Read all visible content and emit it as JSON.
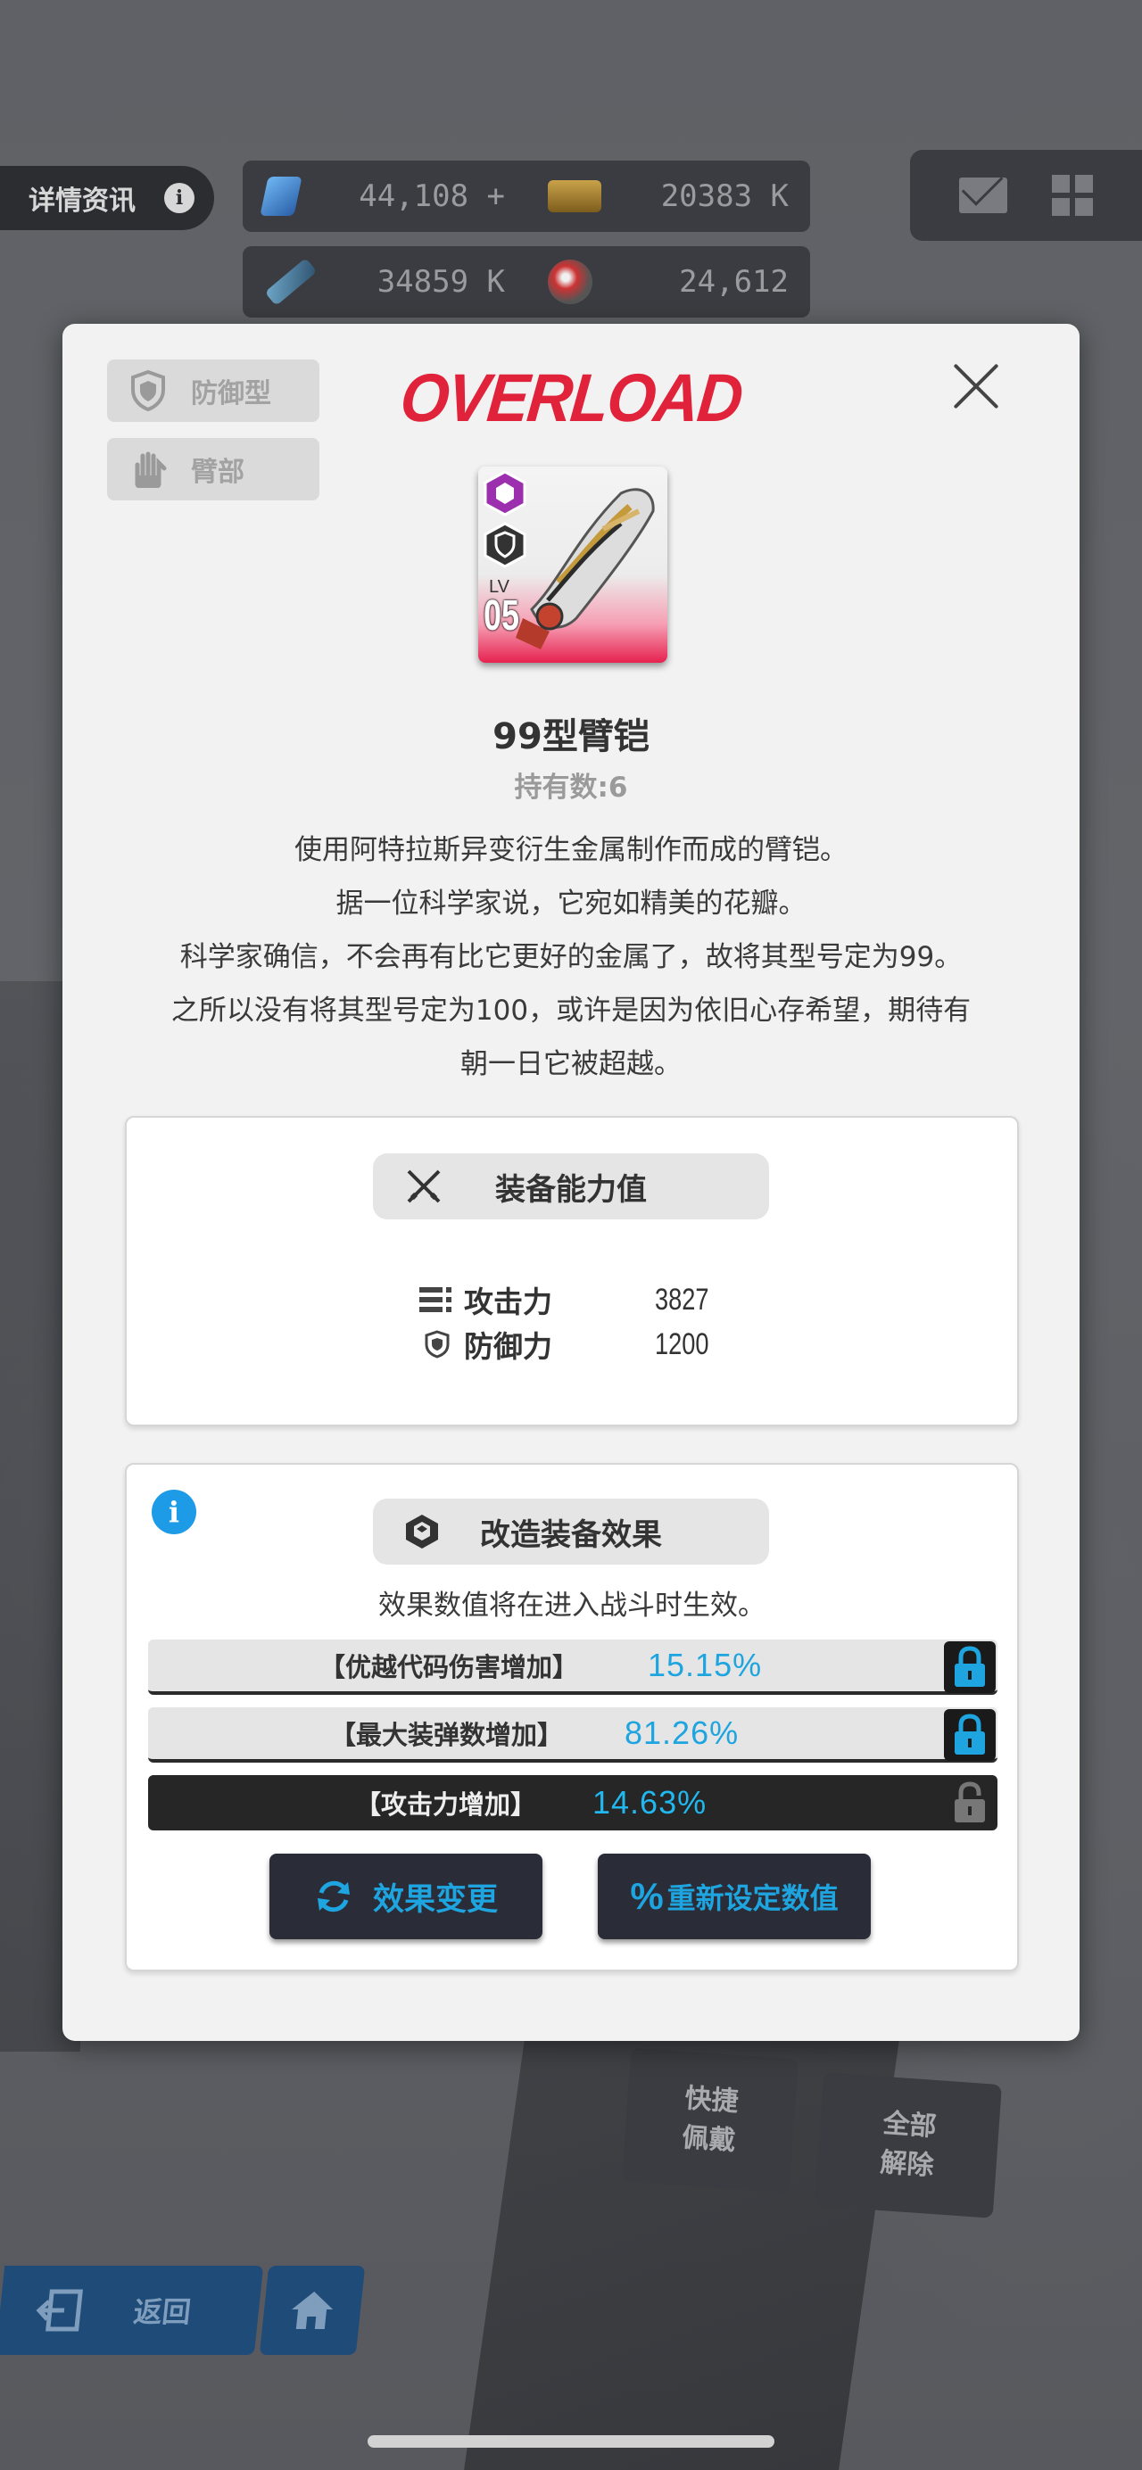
{
  "topbar": {
    "details_label": "详情资讯",
    "resources": [
      {
        "icon": "blue-crystal-icon",
        "value": "44,108 +"
      },
      {
        "icon": "credit-card-icon",
        "value": "20383 K"
      },
      {
        "icon": "battle-data-icon",
        "value": "34859 K"
      },
      {
        "icon": "core-dust-icon",
        "value": "24,612"
      }
    ]
  },
  "modal": {
    "logo": "OVERLOAD",
    "tags": [
      "防御型",
      "臂部"
    ],
    "item": {
      "lv_label": "LV",
      "lv_value": "05",
      "name": "99型臂铠",
      "owned": "持有数:6"
    },
    "description": [
      "使用阿特拉斯异变衍生金属制作而成的臂铠。",
      "据一位科学家说，它宛如精美的花瓣。",
      "科学家确信，不会再有比它更好的金属了，故将其型号定为99。",
      "之所以没有将其型号定为100，或许是因为依旧心存希望，期待有",
      "朝一日它被超越。"
    ],
    "stats_panel": {
      "title": "装备能力值",
      "stats": [
        {
          "label": "攻击力",
          "value": "3827"
        },
        {
          "label": "防御力",
          "value": "1200"
        }
      ]
    },
    "mod_panel": {
      "title": "改造装备效果",
      "note": "效果数值将在进入战斗时生效。",
      "effects": [
        {
          "label": "【优越代码伤害增加】",
          "value": "15.15%",
          "locked": true
        },
        {
          "label": "【最大装弹数增加】",
          "value": "81.26%",
          "locked": true
        },
        {
          "label": "【攻击力增加】",
          "value": "14.63%",
          "locked": false
        }
      ],
      "buttons": {
        "change": "效果变更",
        "reset": "重新设定数值"
      }
    }
  },
  "hud": {
    "quick_equip": "快捷\n佩戴",
    "remove_all": "全部\n解除",
    "back": "返回"
  },
  "colors": {
    "accent_blue": "#1ea5e0",
    "overload_red": "#e0223a",
    "rarity_purple": "#9b2fae"
  }
}
